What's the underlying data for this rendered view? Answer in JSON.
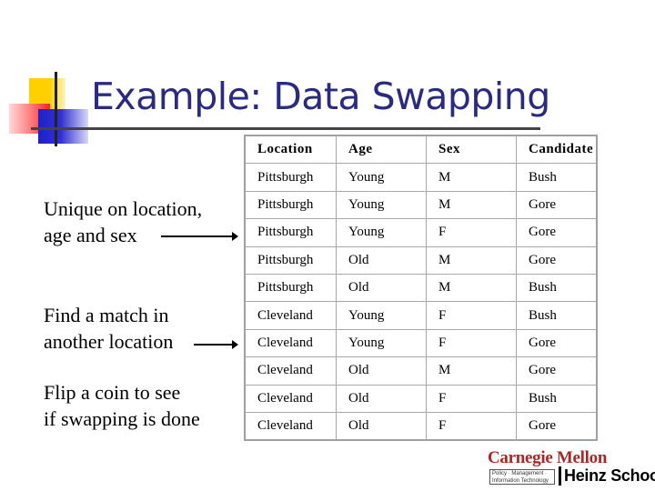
{
  "slide": {
    "title": "Example: Data Swapping",
    "annotations": [
      {
        "line1": "Unique on location,",
        "line2": "age and sex"
      },
      {
        "line1": "Find a match in",
        "line2": "another location"
      },
      {
        "line1": "Flip a coin to see",
        "line2": "if swapping is done"
      }
    ],
    "table": {
      "headers": [
        "Location",
        "Age",
        "Sex",
        "Candidate"
      ],
      "rows": [
        [
          "Pittsburgh",
          "Young",
          "M",
          "Bush"
        ],
        [
          "Pittsburgh",
          "Young",
          "M",
          "Gore"
        ],
        [
          "Pittsburgh",
          "Young",
          "F",
          "Gore"
        ],
        [
          "Pittsburgh",
          "Old",
          "M",
          "Gore"
        ],
        [
          "Pittsburgh",
          "Old",
          "M",
          "Bush"
        ],
        [
          "Cleveland",
          "Young",
          "F",
          "Bush"
        ],
        [
          "Cleveland",
          "Young",
          "F",
          "Gore"
        ],
        [
          "Cleveland",
          "Old",
          "M",
          "Gore"
        ],
        [
          "Cleveland",
          "Old",
          "F",
          "Bush"
        ],
        [
          "Cleveland",
          "Old",
          "F",
          "Gore"
        ]
      ]
    },
    "logo": {
      "university": "Carnegie Mellon",
      "tagline_1": "Policy · Management ·",
      "tagline_2": "Information Technology",
      "school": "Heinz School"
    },
    "colors": {
      "title": "#2a2a80",
      "logo_red": "#a82828"
    }
  }
}
